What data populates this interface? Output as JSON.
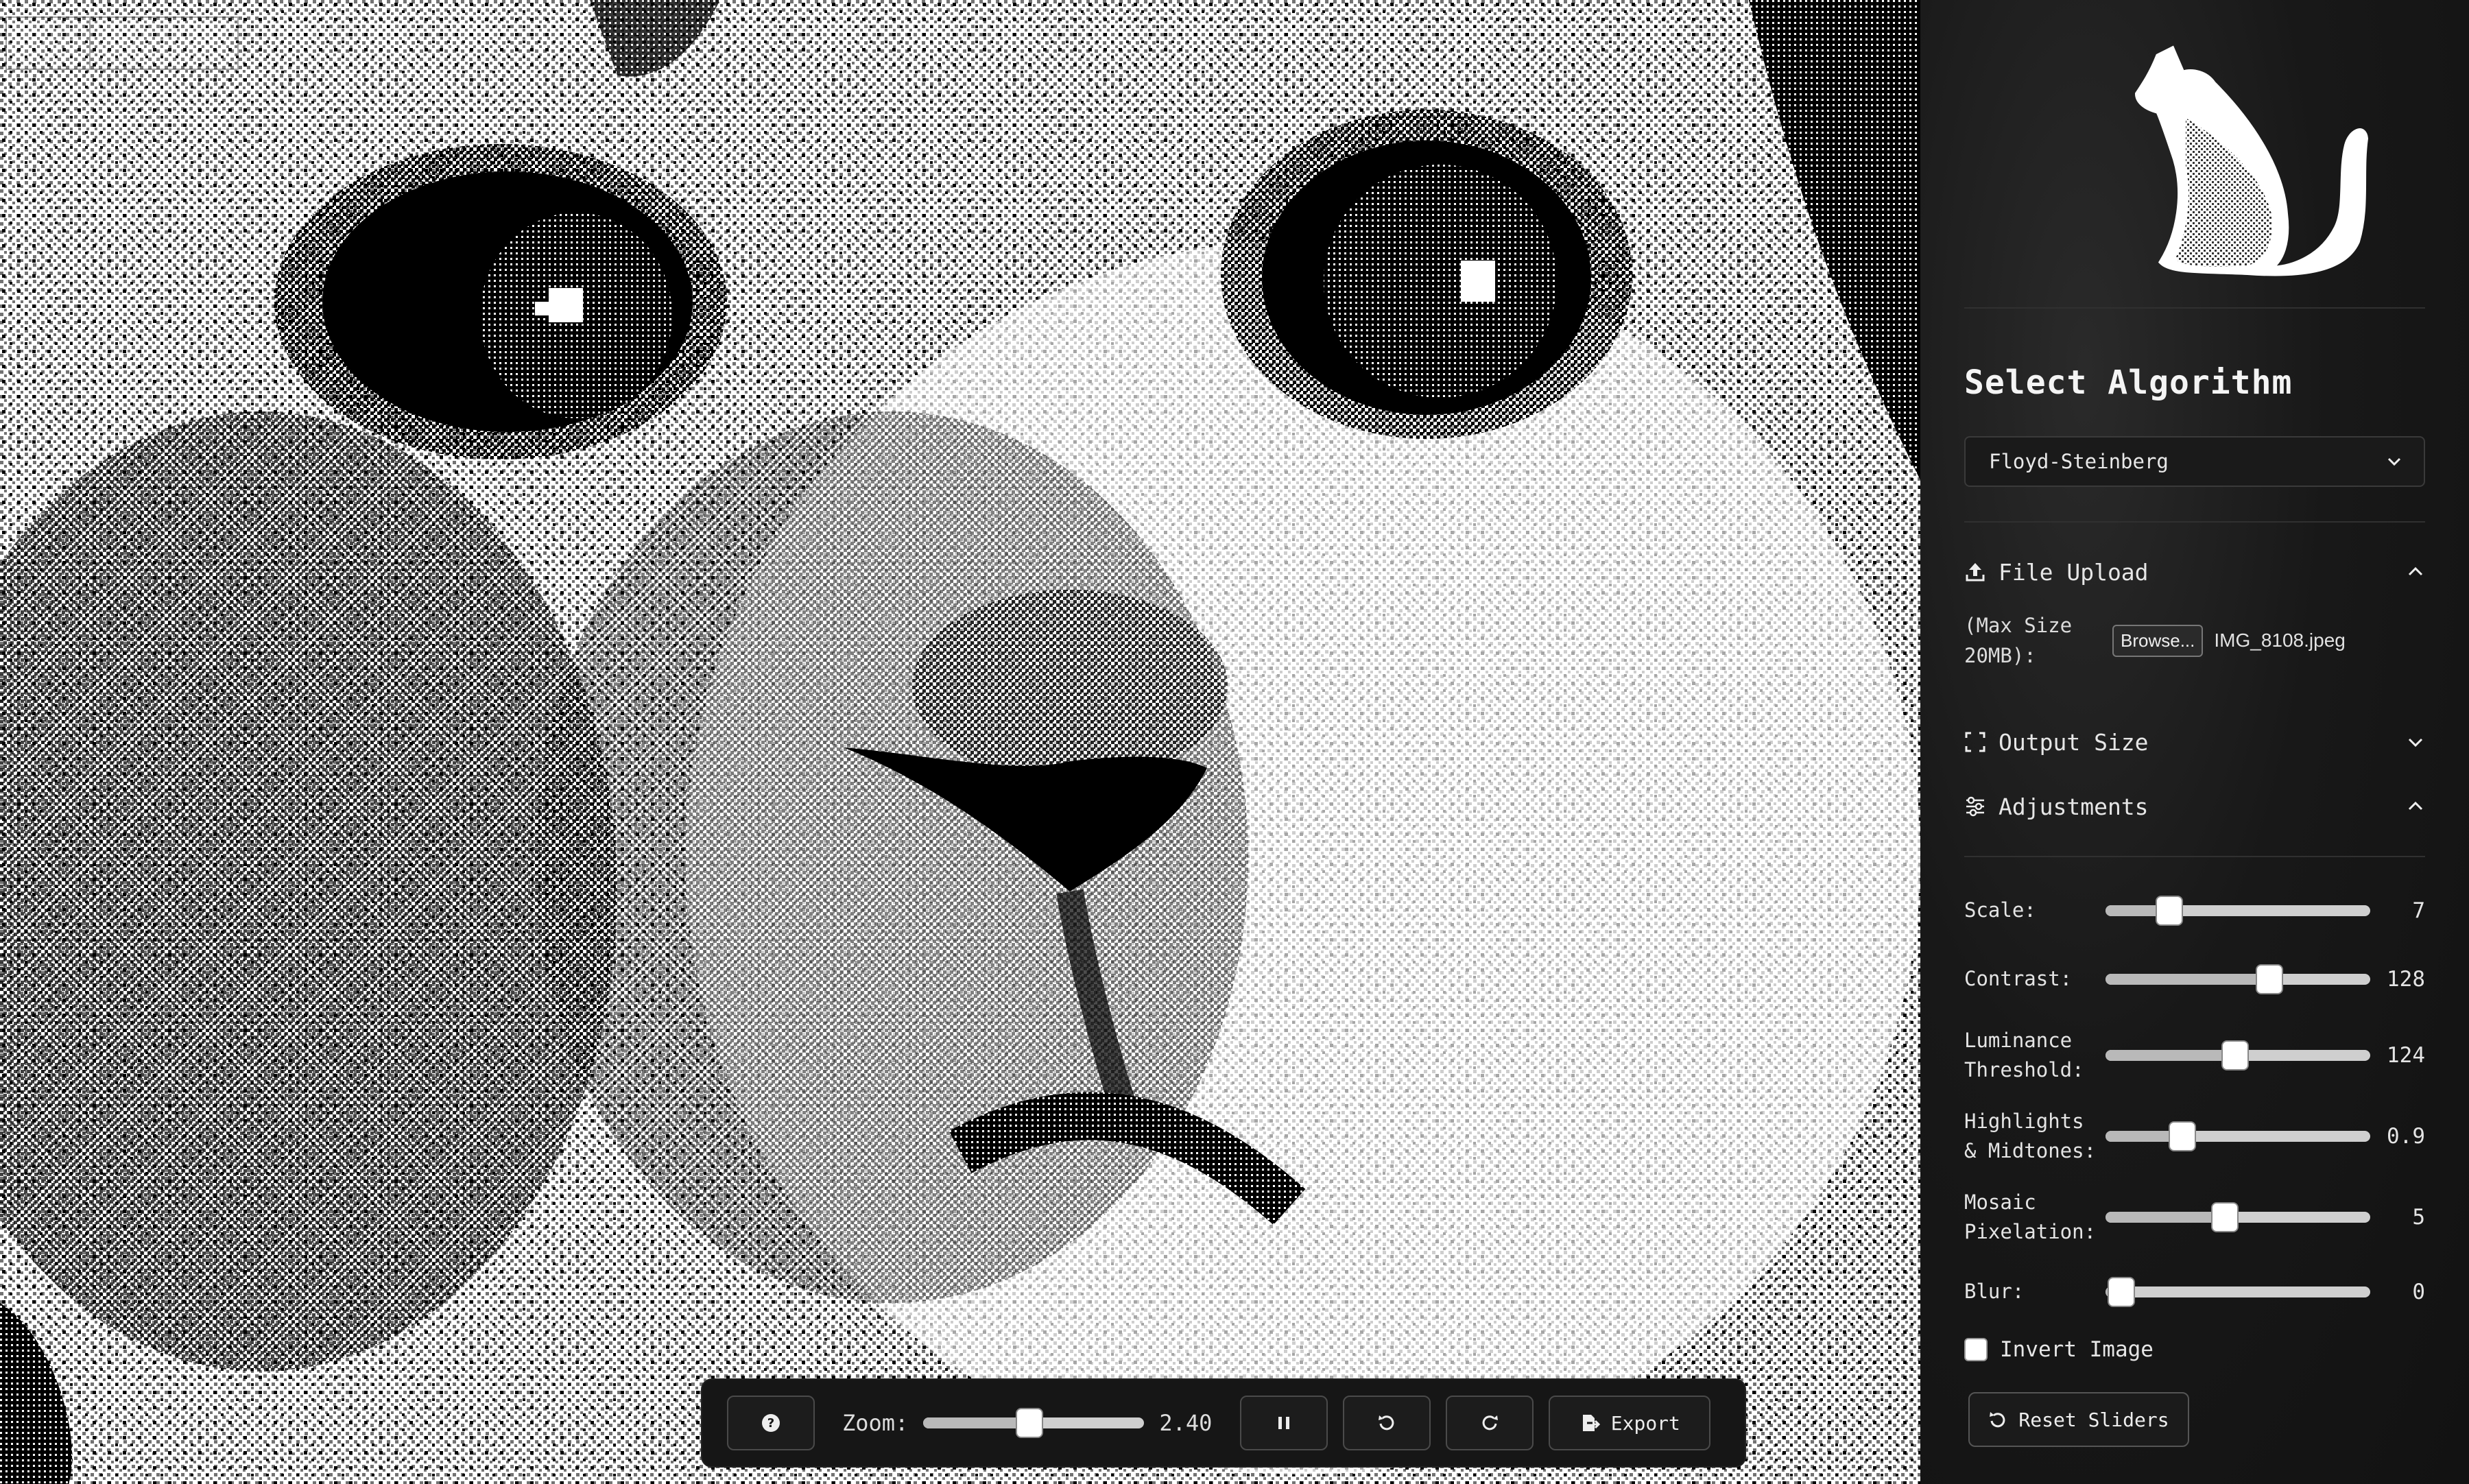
{
  "canvas": {
    "credit": ""
  },
  "toolbar": {
    "help_icon": "?",
    "zoom_label": "Zoom:",
    "zoom_value": "2.40",
    "zoom_fraction": 0.48,
    "export_label": "Export"
  },
  "panel": {
    "title": "Select Algorithm",
    "algorithm": "Floyd-Steinberg",
    "file_upload": {
      "label": "File Upload",
      "note": "(Max Size 20MB):",
      "browse_label": "Browse...",
      "filename": "IMG_8108.jpeg"
    },
    "output_size": {
      "label": "Output Size"
    },
    "adjustments": {
      "label": "Adjustments",
      "sliders": [
        {
          "label": "Scale:",
          "value": "7",
          "fraction": 0.24
        },
        {
          "label": "Contrast:",
          "value": "128",
          "fraction": 0.62
        },
        {
          "label": "Luminance Threshold:",
          "value": "124",
          "fraction": 0.49
        },
        {
          "label": "Highlights & Midtones:",
          "value": "0.9",
          "fraction": 0.29
        },
        {
          "label": "Mosaic Pixelation:",
          "value": "5",
          "fraction": 0.45
        },
        {
          "label": "Blur:",
          "value": "0",
          "fraction": 0.06
        }
      ]
    },
    "invert_label": "Invert Image",
    "invert_checked": false,
    "reset_label": "Reset Sliders"
  },
  "colors": {
    "panel_bg": "#141414",
    "accent": "#ffffff",
    "canvas_bg": "#ffffff"
  }
}
